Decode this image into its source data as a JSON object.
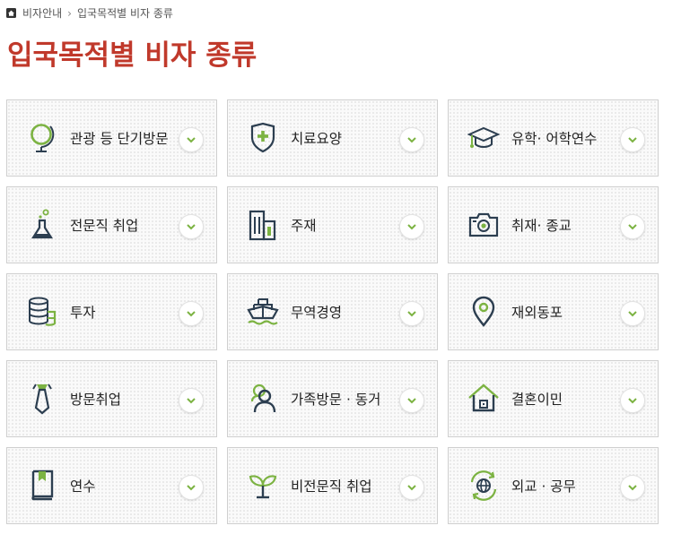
{
  "breadcrumb": {
    "parent": "비자안내",
    "current": "입국목적별 비자 종류"
  },
  "page": {
    "title": "입국목적별 비자 종류"
  },
  "colors": {
    "title": "#c0392b",
    "icon_primary": "#2c3e50",
    "icon_accent": "#7cb342"
  },
  "cards": [
    {
      "label": "관광 등 단기방문",
      "icon": "globe-icon"
    },
    {
      "label": "치료요양",
      "icon": "medical-shield-icon"
    },
    {
      "label": "유학· 어학연수",
      "icon": "graduation-cap-icon"
    },
    {
      "label": "전문직 취업",
      "icon": "flask-icon"
    },
    {
      "label": "주재",
      "icon": "building-icon"
    },
    {
      "label": "취재· 종교",
      "icon": "camera-icon"
    },
    {
      "label": "투자",
      "icon": "coins-icon"
    },
    {
      "label": "무역경영",
      "icon": "ship-icon"
    },
    {
      "label": "재외동포",
      "icon": "location-pin-icon"
    },
    {
      "label": "방문취업",
      "icon": "necktie-icon"
    },
    {
      "label": "가족방문 · 동거",
      "icon": "family-user-icon"
    },
    {
      "label": "결혼이민",
      "icon": "home-icon"
    },
    {
      "label": "연수",
      "icon": "book-icon"
    },
    {
      "label": "비전문직 취업",
      "icon": "sprout-icon"
    },
    {
      "label": "외교 · 공무",
      "icon": "globe-refresh-icon"
    }
  ]
}
